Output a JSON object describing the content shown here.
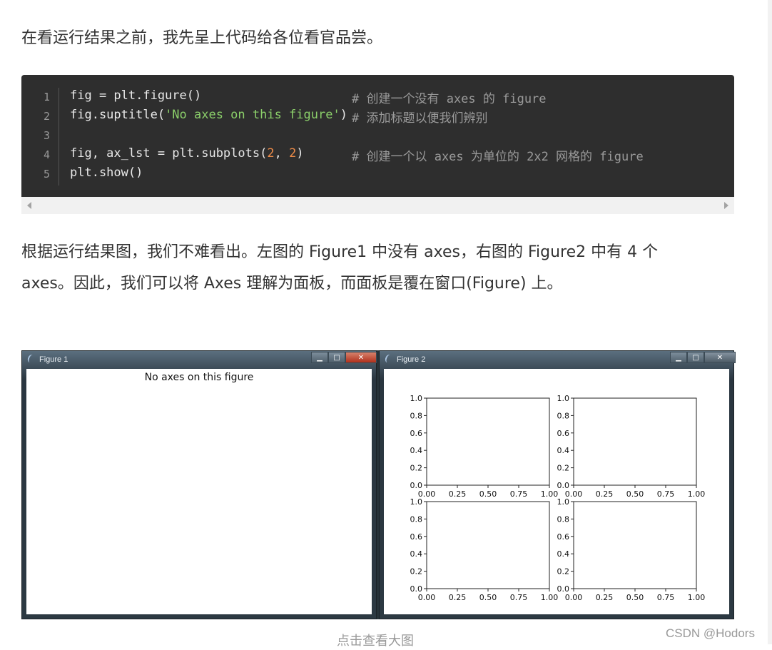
{
  "intro_text": "在看运行结果之前，我先呈上代码给各位看官品尝。",
  "code": {
    "line_numbers": [
      "1",
      "2",
      "3",
      "4",
      "5"
    ],
    "l1_code": "fig = plt.figure()",
    "l1_comment": "# 创建一个没有 axes 的 figure",
    "l2_a": "fig.suptitle(",
    "l2_str": "'No axes on this figure'",
    "l2_b": ")",
    "l2_comment": "# 添加标题以便我们辨别",
    "l4_a": "fig, ax_lst = plt.subplots(",
    "l4_n1": "2",
    "l4_sep": ", ",
    "l4_n2": "2",
    "l4_b": ")",
    "l4_comment": "# 创建一个以 axes 为单位的 2x2 网格的 figure",
    "l5_code": "plt.show()"
  },
  "explain_line1": "根据运行结果图，我们不难看出。左图的 Figure1 中没有 axes，右图的 Figure2 中有 4 个",
  "explain_line2": "axes。因此，我们可以将 Axes 理解为面板，而面板是覆在窗口(Figure) 上。",
  "figure1": {
    "window_title": "Figure 1",
    "suptitle": "No axes on this figure",
    "buttons": {
      "minimize": "▁",
      "maximize": "□",
      "close": "✕"
    }
  },
  "figure2": {
    "window_title": "Figure 2",
    "buttons": {
      "minimize": "▁",
      "maximize": "□",
      "close": "✕"
    }
  },
  "chart_data": {
    "type": "scatter",
    "layout": "2x2 empty subplots",
    "xlim": [
      0,
      1
    ],
    "ylim": [
      0,
      1
    ],
    "xticks": [
      "0.00",
      "0.25",
      "0.50",
      "0.75",
      "1.00"
    ],
    "yticks": [
      "0.0",
      "0.2",
      "0.4",
      "0.6",
      "0.8",
      "1.0"
    ],
    "series": []
  },
  "caption": "点击查看大图",
  "watermark": "CSDN @Hodors"
}
